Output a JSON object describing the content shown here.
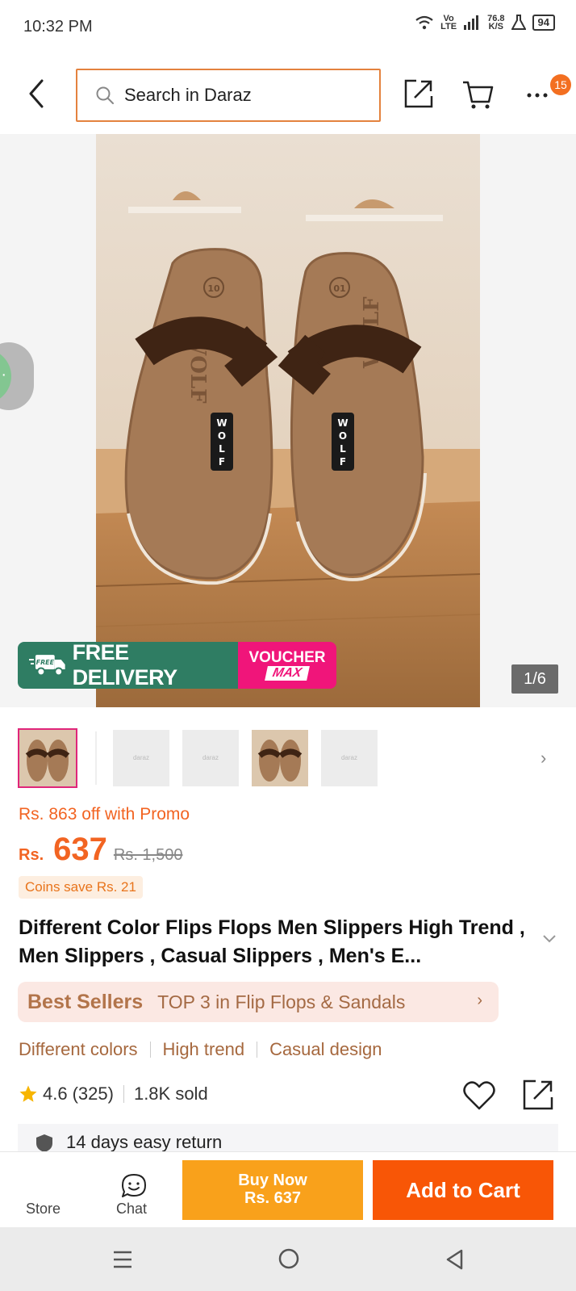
{
  "status_bar": {
    "time": "10:32 PM",
    "network_top": "Vo",
    "network_bottom": "LTE",
    "speed_value": "76.8",
    "speed_unit": "K/S",
    "battery": "94"
  },
  "top_nav": {
    "search_placeholder": "Search in Daraz",
    "notification_count": "15"
  },
  "hero": {
    "banner_delivery": "FREE DELIVERY",
    "banner_free_tag": "FREE",
    "voucher_title": "VOUCHER",
    "voucher_sub": "MAX",
    "page_counter": "1/6",
    "sandal_brand": "WOLF",
    "sandal_size": "10"
  },
  "pricing": {
    "promo": "Rs. 863 off with Promo",
    "currency": "Rs.",
    "price": "637",
    "old_price": "Rs. 1,500",
    "coins": "Coins save Rs. 21"
  },
  "product": {
    "title": "Different Color Flips Flops Men Slippers High Trend , Men Slippers , Casual Slippers , Men's E..."
  },
  "best_sellers": {
    "label": "Best Sellers",
    "rank": "TOP 3 in Flip Flops & Sandals"
  },
  "tags": [
    "Different colors",
    "High trend",
    "Casual design"
  ],
  "rating": {
    "score": "4.6",
    "count": "(325)",
    "sold": "1.8K sold"
  },
  "return_policy": "14 days easy return",
  "bottom_bar": {
    "store": "Store",
    "chat": "Chat",
    "buy_now": "Buy Now",
    "buy_now_price": "Rs. 637",
    "add_to_cart": "Add to Cart"
  },
  "colors": {
    "accent_orange": "#f85606",
    "buy_now_yellow": "#f9a11b",
    "delivery_green": "#2f7d63",
    "voucher_pink": "#f0157a"
  }
}
